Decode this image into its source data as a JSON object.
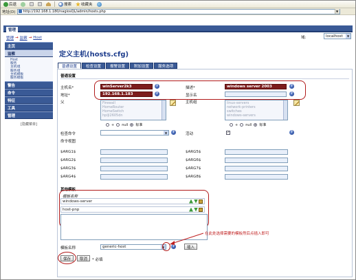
{
  "browser": {
    "toolbar": [
      "后退",
      "搜索",
      "收藏夹"
    ],
    "address_label": "地址(D)",
    "url": "http://192.168.1.180/nagiosQL/admin/hosts.php"
  },
  "topnav": {
    "tab": "管理"
  },
  "breadcrumb": [
    "管理",
    "监察",
    "Host"
  ],
  "domain": {
    "label": "域:",
    "value": "localhost"
  },
  "menu": {
    "items": [
      "主页",
      "监察",
      "警告",
      "命令",
      "特征",
      "工具",
      "管理"
    ],
    "active_sub": [
      "Host",
      "服务",
      "主机组",
      "服务组",
      "主机模板",
      "服务模板"
    ],
    "footer": "[隐藏菜单]"
  },
  "page": {
    "title": "定义主机(hosts.cfg)"
  },
  "tabs": [
    "普通设置",
    "检查设置",
    "报警设置",
    "附加设置",
    "服务选项"
  ],
  "form": {
    "section_general": "普通设置",
    "host_name_label": "主机名*",
    "host_name": "winServer2k3",
    "alias_label": "描述*",
    "alias": "windows server 2003",
    "address_label": "地址*",
    "address": "192.168.1.183",
    "display_name_label": "显示名",
    "parent_label": "父",
    "parents": [
      "Firewall",
      "HomeRouter",
      "HomeSwitch",
      "hpljl2605dn"
    ],
    "hostgroups_label": "主机组",
    "hostgroups": [
      "linux-servers",
      "network-printers",
      "switches",
      "windows-servers"
    ],
    "radio_null": "null",
    "radio_std": "标准",
    "check_command_label": "检查命令",
    "active_label": "活动",
    "active_checked": "✓",
    "command_view_label": "命令视图",
    "args": [
      "$ARG1$",
      "$ARG2$",
      "$ARG3$",
      "$ARG4$",
      "$ARG5$",
      "$ARG6$",
      "$ARG7$",
      "$ARG8$"
    ],
    "section_templates": "其他模板",
    "template_header": "模板名称",
    "templates": [
      "windows-server",
      "host-pnp"
    ],
    "template_name_label": "模板名称",
    "template_select": "generic-host",
    "insert_button": "插入",
    "annotation": "在此处选择需要的模板然后点插入即可",
    "save_button": "保存",
    "cancel_button": "取消",
    "required_note": "* 必填"
  },
  "colors": {
    "nav": "#3a5a96",
    "highlight": "#7d1d1d",
    "annotation": "#c02020"
  }
}
